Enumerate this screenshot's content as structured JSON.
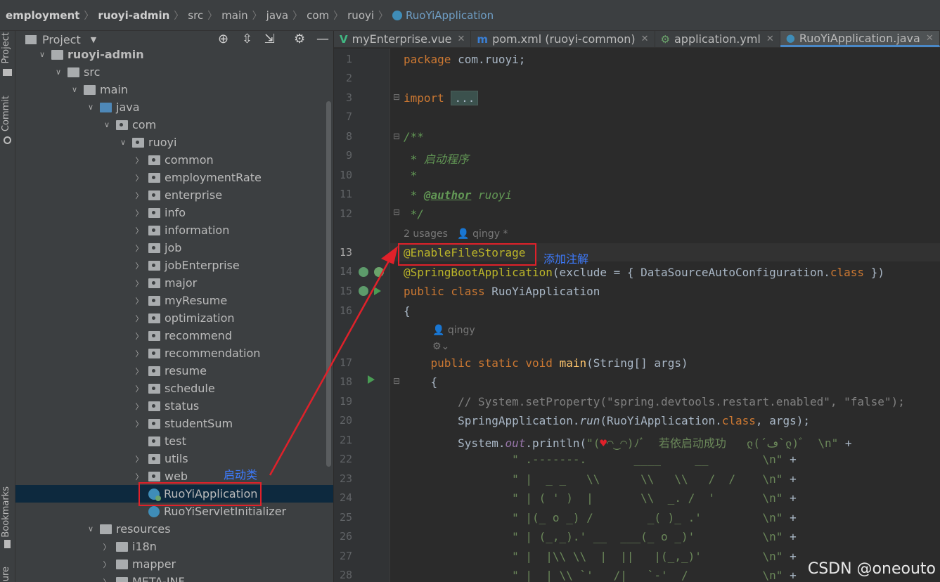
{
  "breadcrumb": [
    "employment",
    "ruoyi-admin",
    "src",
    "main",
    "java",
    "com",
    "ruoyi",
    "RuoYiApplication"
  ],
  "left_strip": {
    "project": "Project",
    "commit": "Commit",
    "bookmarks": "Bookmarks",
    "structure": "ure"
  },
  "project_panel": {
    "title": "Project",
    "tree": [
      {
        "label": "ruoyi-admin",
        "depth": 1,
        "arrow": "down",
        "icon": "module",
        "bold": true
      },
      {
        "label": "src",
        "depth": 2,
        "arrow": "down",
        "icon": "folder"
      },
      {
        "label": "main",
        "depth": 3,
        "arrow": "down",
        "icon": "folder"
      },
      {
        "label": "java",
        "depth": 4,
        "arrow": "down",
        "icon": "folder-blue"
      },
      {
        "label": "com",
        "depth": 5,
        "arrow": "down",
        "icon": "package"
      },
      {
        "label": "ruoyi",
        "depth": 6,
        "arrow": "down",
        "icon": "package"
      },
      {
        "label": "common",
        "depth": 7,
        "arrow": "right",
        "icon": "package"
      },
      {
        "label": "employmentRate",
        "depth": 7,
        "arrow": "right",
        "icon": "package"
      },
      {
        "label": "enterprise",
        "depth": 7,
        "arrow": "right",
        "icon": "package"
      },
      {
        "label": "info",
        "depth": 7,
        "arrow": "right",
        "icon": "package"
      },
      {
        "label": "information",
        "depth": 7,
        "arrow": "right",
        "icon": "package"
      },
      {
        "label": "job",
        "depth": 7,
        "arrow": "right",
        "icon": "package"
      },
      {
        "label": "jobEnterprise",
        "depth": 7,
        "arrow": "right",
        "icon": "package"
      },
      {
        "label": "major",
        "depth": 7,
        "arrow": "right",
        "icon": "package"
      },
      {
        "label": "myResume",
        "depth": 7,
        "arrow": "right",
        "icon": "package"
      },
      {
        "label": "optimization",
        "depth": 7,
        "arrow": "right",
        "icon": "package"
      },
      {
        "label": "recommend",
        "depth": 7,
        "arrow": "right",
        "icon": "package"
      },
      {
        "label": "recommendation",
        "depth": 7,
        "arrow": "right",
        "icon": "package"
      },
      {
        "label": "resume",
        "depth": 7,
        "arrow": "right",
        "icon": "package"
      },
      {
        "label": "schedule",
        "depth": 7,
        "arrow": "right",
        "icon": "package"
      },
      {
        "label": "status",
        "depth": 7,
        "arrow": "right",
        "icon": "package"
      },
      {
        "label": "studentSum",
        "depth": 7,
        "arrow": "right",
        "icon": "package"
      },
      {
        "label": "test",
        "depth": 7,
        "arrow": "none",
        "icon": "package"
      },
      {
        "label": "utils",
        "depth": 7,
        "arrow": "right",
        "icon": "package"
      },
      {
        "label": "web",
        "depth": 7,
        "arrow": "right",
        "icon": "package"
      },
      {
        "label": "RuoYiApplication",
        "depth": 7,
        "arrow": "none",
        "icon": "spring-class",
        "selected": true
      },
      {
        "label": "RuoYiServletInitializer",
        "depth": 7,
        "arrow": "none",
        "icon": "class"
      },
      {
        "label": "resources",
        "depth": 4,
        "arrow": "down",
        "icon": "folder-res"
      },
      {
        "label": "i18n",
        "depth": 5,
        "arrow": "right",
        "icon": "folder"
      },
      {
        "label": "mapper",
        "depth": 5,
        "arrow": "right",
        "icon": "folder"
      },
      {
        "label": "META-INF",
        "depth": 5,
        "arrow": "right",
        "icon": "folder"
      }
    ]
  },
  "annotations": {
    "startup_class": "启动类",
    "add_annotation": "添加注解"
  },
  "tabs": [
    {
      "label": "myEnterprise.vue",
      "icon": "vue-icon",
      "color": "#41b883"
    },
    {
      "label": "pom.xml (ruoyi-common)",
      "icon": "maven-icon",
      "color": "#3a7fd5"
    },
    {
      "label": "application.yml",
      "icon": "spring-yml-icon",
      "color": "#6ba36b"
    },
    {
      "label": "RuoYiApplication.java",
      "icon": "spring-class-icon",
      "color": "#3f8db8",
      "active": true
    }
  ],
  "editor": {
    "line_numbers": [
      1,
      2,
      3,
      7,
      8,
      9,
      10,
      11,
      12,
      13,
      14,
      15,
      16,
      17,
      18,
      19,
      20,
      21,
      22,
      23,
      24,
      25,
      26,
      27,
      28
    ],
    "current_line": 13,
    "usages_hint": "2 usages",
    "author_hint": "qingy *",
    "author_hint_main": "qingy"
  },
  "watermark": "CSDN @oneouto"
}
